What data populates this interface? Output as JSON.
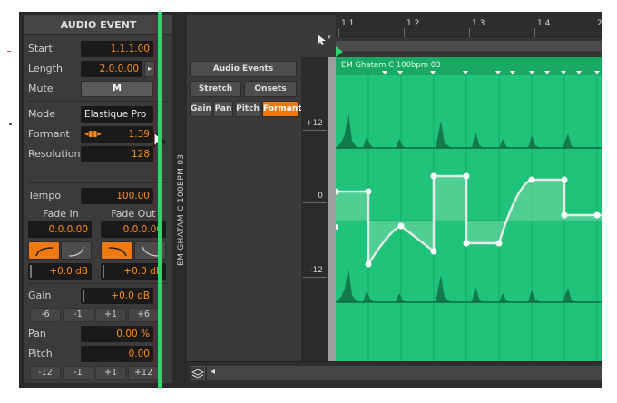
{
  "inspector": {
    "title": "AUDIO EVENT",
    "start_label": "Start",
    "start_value": "1.1.1.00",
    "length_label": "Length",
    "length_value": "2.0.0.00",
    "mute_label": "Mute",
    "mute_button": "M",
    "mode_label": "Mode",
    "mode_value": "Elastique Pro",
    "formant_label": "Formant",
    "formant_value": "1.39",
    "resolution_label": "Resolution",
    "resolution_value": "128",
    "tempo_label": "Tempo",
    "tempo_value": "100.00",
    "fade_in_label": "Fade In",
    "fade_out_label": "Fade Out",
    "fade_in_value": "0.0.0.00",
    "fade_out_value": "0.0.0.00",
    "fade_in_gain": "+0.0 dB",
    "fade_out_gain": "+0.0 dB",
    "gain_label": "Gain",
    "gain_value": "+0.0 dB",
    "gain_steps": [
      "-6",
      "-1",
      "+1",
      "+6"
    ],
    "pan_label": "Pan",
    "pan_value": "0.00 %",
    "pitch_label": "Pitch",
    "pitch_value": "0.00",
    "pitch_steps": [
      "-12",
      "-1",
      "+1",
      "+12"
    ]
  },
  "track": {
    "name": "EM GHATAM C 100BPM 03",
    "color": "#2fd46a"
  },
  "editor": {
    "ruler_marks": [
      "1.1",
      "1.2",
      "1.3",
      "1.4",
      "2"
    ],
    "clip_name": "EM Ghatam C 100bpm 03",
    "buttons": {
      "audio_events": "Audio Events",
      "stretch": "Stretch",
      "onsets": "Onsets",
      "gain": "Gain",
      "pan": "Pan",
      "pitch": "Pitch",
      "formant": "Formant"
    },
    "scale": [
      "+12",
      "0",
      "-12"
    ],
    "accent_color": "#f07a10",
    "clip_color": "#1fc37a"
  }
}
